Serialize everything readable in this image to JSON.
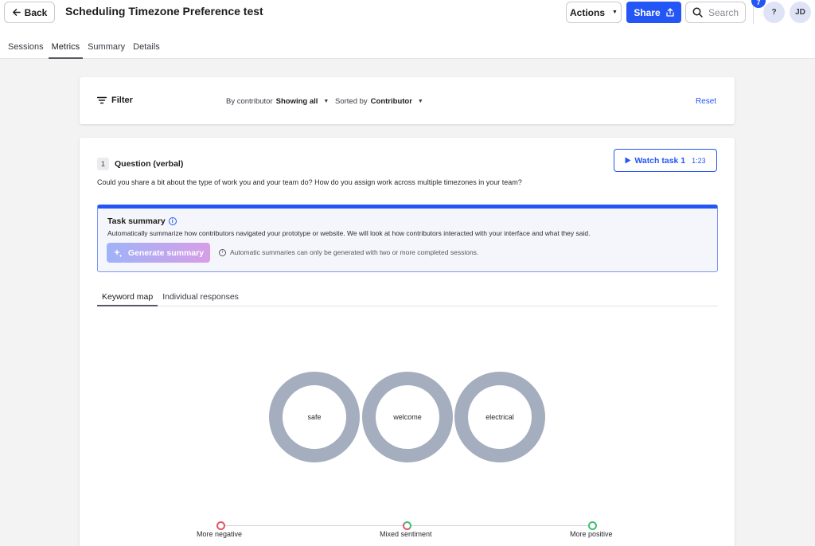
{
  "header": {
    "back_label": "Back",
    "title": "Scheduling Timezone Preference test",
    "actions_label": "Actions",
    "share_label": "Share",
    "search_placeholder": "Search",
    "help_label": "?",
    "user_initials": "JD",
    "notification_count": "7"
  },
  "tabs": [
    {
      "label": "Sessions"
    },
    {
      "label": "Metrics"
    },
    {
      "label": "Summary"
    },
    {
      "label": "Details"
    }
  ],
  "filter": {
    "label": "Filter",
    "by_prefix": "By contributor",
    "by_value": "Showing all",
    "sort_prefix": "Sorted by",
    "sort_value": "Contributor",
    "reset_label": "Reset"
  },
  "question": {
    "number": "1",
    "title": "Question (verbal)",
    "text": "Could you share a bit about the type of work you and your team do? How do you assign work across multiple timezones in your team?",
    "watch_label": "Watch task 1",
    "watch_duration": "1:23"
  },
  "task_summary": {
    "title": "Task summary",
    "description": "Automatically summarize how contributors navigated your prototype or website. We will look at how contributors interacted with your interface and what they said.",
    "generate_label": "Generate summary",
    "note": "Automatic summaries can only be generated with two or more completed sessions."
  },
  "sub_tabs": [
    {
      "label": "Keyword map"
    },
    {
      "label": "Individual responses"
    }
  ],
  "keywords": [
    {
      "word": "safe"
    },
    {
      "word": "welcome"
    },
    {
      "word": "electrical"
    }
  ],
  "sentiment_legend": {
    "negative": "More negative",
    "mixed": "Mixed sentiment",
    "positive": "More positive"
  },
  "colors": {
    "primary": "#2456f5",
    "bubble": "#a5aebe",
    "negative": "#e05767",
    "positive": "#3cbf6f"
  }
}
